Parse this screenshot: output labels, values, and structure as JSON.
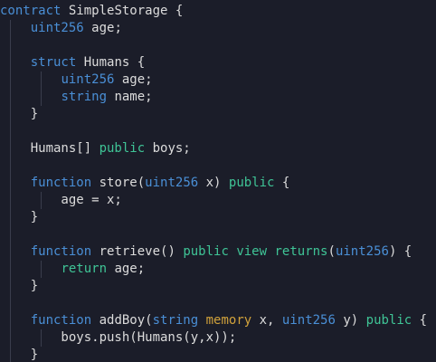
{
  "editor": {
    "colors": {
      "background": "#1b1d29",
      "keyword": "#4a8fd6",
      "access_modifier": "#3fc496",
      "memory": "#d1a23b",
      "text": "#dcdcdc"
    },
    "lines": [
      [
        {
          "t": "contract",
          "c": "kw"
        },
        {
          "t": " SimpleStorage {",
          "c": "plain"
        }
      ],
      [
        {
          "t": "    ",
          "c": "plain"
        },
        {
          "t": "uint256",
          "c": "kw"
        },
        {
          "t": " age;",
          "c": "plain"
        }
      ],
      [],
      [
        {
          "t": "    ",
          "c": "plain"
        },
        {
          "t": "struct",
          "c": "kw"
        },
        {
          "t": " Humans {",
          "c": "plain"
        }
      ],
      [
        {
          "t": "        ",
          "c": "plain"
        },
        {
          "t": "uint256",
          "c": "kw"
        },
        {
          "t": " age;",
          "c": "plain"
        }
      ],
      [
        {
          "t": "        ",
          "c": "plain"
        },
        {
          "t": "string",
          "c": "kw"
        },
        {
          "t": " name;",
          "c": "plain"
        }
      ],
      [
        {
          "t": "    }",
          "c": "plain"
        }
      ],
      [],
      [
        {
          "t": "    Humans[] ",
          "c": "plain"
        },
        {
          "t": "public",
          "c": "acc"
        },
        {
          "t": " boys;",
          "c": "plain"
        }
      ],
      [],
      [
        {
          "t": "    ",
          "c": "plain"
        },
        {
          "t": "function",
          "c": "kw"
        },
        {
          "t": " store(",
          "c": "plain"
        },
        {
          "t": "uint256",
          "c": "kw"
        },
        {
          "t": " x) ",
          "c": "plain"
        },
        {
          "t": "public",
          "c": "acc"
        },
        {
          "t": " {",
          "c": "plain"
        }
      ],
      [
        {
          "t": "        age = x;",
          "c": "plain"
        }
      ],
      [
        {
          "t": "    }",
          "c": "plain"
        }
      ],
      [],
      [
        {
          "t": "    ",
          "c": "plain"
        },
        {
          "t": "function",
          "c": "kw"
        },
        {
          "t": " retrieve() ",
          "c": "plain"
        },
        {
          "t": "public",
          "c": "acc"
        },
        {
          "t": " ",
          "c": "plain"
        },
        {
          "t": "view",
          "c": "acc"
        },
        {
          "t": " ",
          "c": "plain"
        },
        {
          "t": "returns",
          "c": "acc"
        },
        {
          "t": "(",
          "c": "plain"
        },
        {
          "t": "uint256",
          "c": "kw"
        },
        {
          "t": ") {",
          "c": "plain"
        }
      ],
      [
        {
          "t": "        ",
          "c": "plain"
        },
        {
          "t": "return",
          "c": "acc"
        },
        {
          "t": " age;",
          "c": "plain"
        }
      ],
      [
        {
          "t": "    }",
          "c": "plain"
        }
      ],
      [],
      [
        {
          "t": "    ",
          "c": "plain"
        },
        {
          "t": "function",
          "c": "kw"
        },
        {
          "t": " addBoy(",
          "c": "plain"
        },
        {
          "t": "string",
          "c": "kw"
        },
        {
          "t": " ",
          "c": "plain"
        },
        {
          "t": "memory",
          "c": "mem"
        },
        {
          "t": " x, ",
          "c": "plain"
        },
        {
          "t": "uint256",
          "c": "kw"
        },
        {
          "t": " y) ",
          "c": "plain"
        },
        {
          "t": "public",
          "c": "acc"
        },
        {
          "t": " {",
          "c": "plain"
        }
      ],
      [
        {
          "t": "        boys.push(Humans(y,x));",
          "c": "plain"
        }
      ],
      [
        {
          "t": "    }",
          "c": "plain"
        }
      ]
    ]
  }
}
